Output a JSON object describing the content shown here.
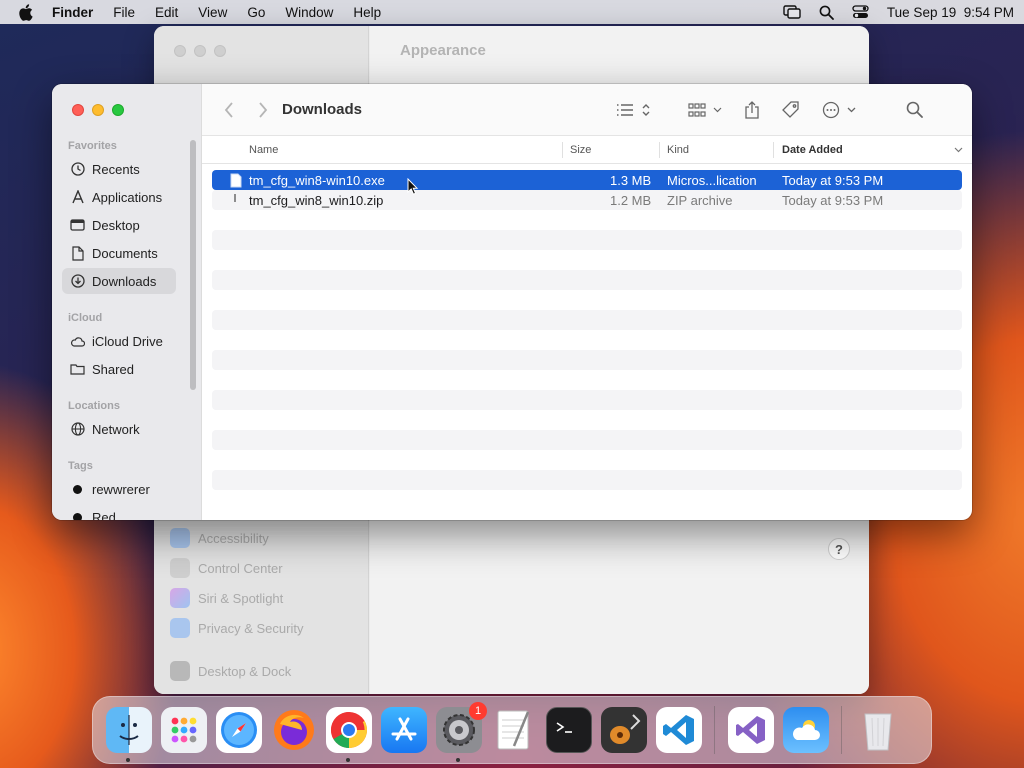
{
  "menubar": {
    "app_name": "Finder",
    "items": [
      "File",
      "Edit",
      "View",
      "Go",
      "Window",
      "Help"
    ],
    "datetime": "Tue Sep 19  9:54 PM"
  },
  "settings_window": {
    "title": "Appearance",
    "items": [
      "Accessibility",
      "Control Center",
      "Siri & Spotlight",
      "Privacy & Security",
      "Desktop & Dock"
    ],
    "help_label": "?"
  },
  "finder": {
    "title": "Downloads",
    "sidebar": {
      "favorites_label": "Favorites",
      "favorites": [
        "Recents",
        "Applications",
        "Desktop",
        "Documents",
        "Downloads"
      ],
      "icloud_label": "iCloud",
      "icloud": [
        "iCloud Drive",
        "Shared"
      ],
      "locations_label": "Locations",
      "locations": [
        "Network"
      ],
      "tags_label": "Tags",
      "tags": [
        "rewwrerer",
        "Red"
      ]
    },
    "columns": {
      "name": "Name",
      "size": "Size",
      "kind": "Kind",
      "date_added": "Date Added"
    },
    "files": [
      {
        "name": "tm_cfg_win8-win10.exe",
        "size": "1.3 MB",
        "kind": "Micros...lication",
        "date": "Today at 9:53 PM",
        "selected": true
      },
      {
        "name": "tm_cfg_win8_win10.zip",
        "size": "1.2 MB",
        "kind": "ZIP archive",
        "date": "Today at 9:53 PM",
        "selected": false
      }
    ]
  },
  "dock": {
    "apps": [
      "Finder",
      "Launchpad",
      "Safari",
      "Firefox",
      "Chrome",
      "App Store",
      "System Settings",
      "TextEdit",
      "Terminal",
      "GarageBand",
      "VS Code",
      "Visual Studio",
      "Weather",
      "Trash"
    ],
    "settings_badge": "1"
  },
  "colors": {
    "selection": "#1c62d6",
    "close": "#ff5f57",
    "minimize": "#febc2e",
    "zoom": "#28c840"
  }
}
